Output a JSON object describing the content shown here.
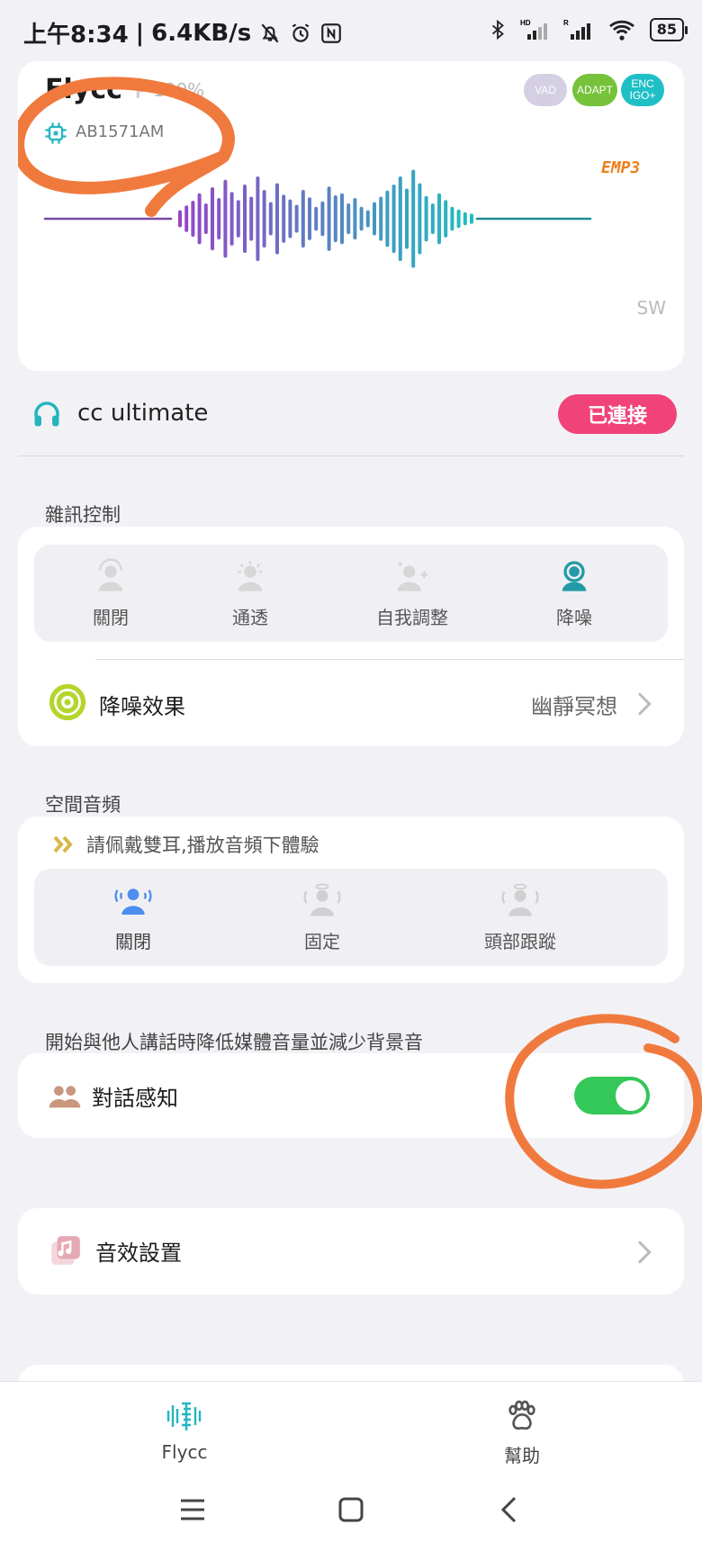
{
  "status_bar": {
    "time": "上午8:34",
    "speed": "6.4KB/s",
    "battery": "85"
  },
  "device_card": {
    "name": "Flycc",
    "battery_percent": "100%",
    "chip": "AB1571AM",
    "badges": [
      "VAD",
      "ADAPT",
      "ENC IGO+"
    ],
    "emp_label": "EMP3",
    "sw_label": "SW"
  },
  "connection": {
    "device_name": "cc ultimate",
    "status_button": "已連接"
  },
  "noise_control": {
    "section_title": "雜訊控制",
    "modes": [
      "關閉",
      "通透",
      "自我調整",
      "降噪"
    ],
    "selected_index": 3,
    "effect_label": "降噪效果",
    "effect_value": "幽靜冥想"
  },
  "spatial_audio": {
    "section_title": "空間音頻",
    "hint": "請佩戴雙耳,播放音頻下體驗",
    "modes": [
      "關閉",
      "固定",
      "頭部跟蹤"
    ],
    "selected_index": 0
  },
  "conversation": {
    "section_title": "開始與他人講話時降低媒體音量並減少背景音",
    "label": "對話感知",
    "enabled": true
  },
  "sound_settings": {
    "label": "音效設置"
  },
  "bottom_tabs": {
    "items": [
      "Flycc",
      "幫助"
    ],
    "selected_index": 0
  },
  "colors": {
    "accent_teal": "#26b5bf",
    "connect_pink": "#f0437a",
    "toggle_green": "#34c759",
    "annotation_orange": "#f07a3e"
  }
}
